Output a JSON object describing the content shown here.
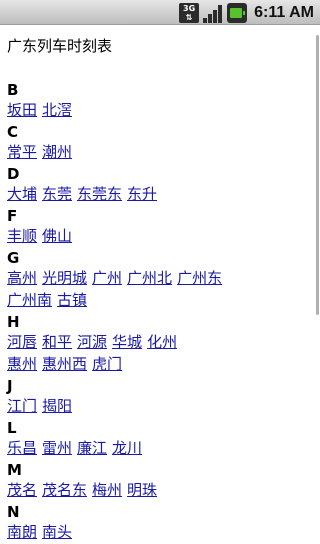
{
  "status_bar": {
    "network": "3G",
    "time": "6:11 AM",
    "icons": [
      "network-3g-icon",
      "signal-icon",
      "battery-charging-icon"
    ]
  },
  "page": {
    "title": "广东列车时刻表"
  },
  "sections": [
    {
      "letter": "B",
      "rows": [
        [
          "坂田",
          "北滘"
        ]
      ]
    },
    {
      "letter": "C",
      "rows": [
        [
          "常平",
          "潮州"
        ]
      ]
    },
    {
      "letter": "D",
      "rows": [
        [
          "大埔",
          "东莞",
          "东莞东",
          "东升"
        ]
      ]
    },
    {
      "letter": "F",
      "rows": [
        [
          "丰顺",
          "佛山"
        ]
      ]
    },
    {
      "letter": "G",
      "rows": [
        [
          "高州",
          "光明城",
          "广州",
          "广州北",
          "广州东"
        ],
        [
          "广州南",
          "古镇"
        ]
      ]
    },
    {
      "letter": "H",
      "rows": [
        [
          "河唇",
          "和平",
          "河源",
          "华城",
          "化州"
        ],
        [
          "惠州",
          "惠州西",
          "虎门"
        ]
      ]
    },
    {
      "letter": "J",
      "rows": [
        [
          "江门",
          "揭阳"
        ]
      ]
    },
    {
      "letter": "L",
      "rows": [
        [
          "乐昌",
          "雷州",
          "廉江",
          "龙川"
        ]
      ]
    },
    {
      "letter": "M",
      "rows": [
        [
          "茂名",
          "茂名东",
          "梅州",
          "明珠"
        ]
      ]
    },
    {
      "letter": "N",
      "rows": [
        [
          "南朗",
          "南头"
        ]
      ]
    }
  ]
}
